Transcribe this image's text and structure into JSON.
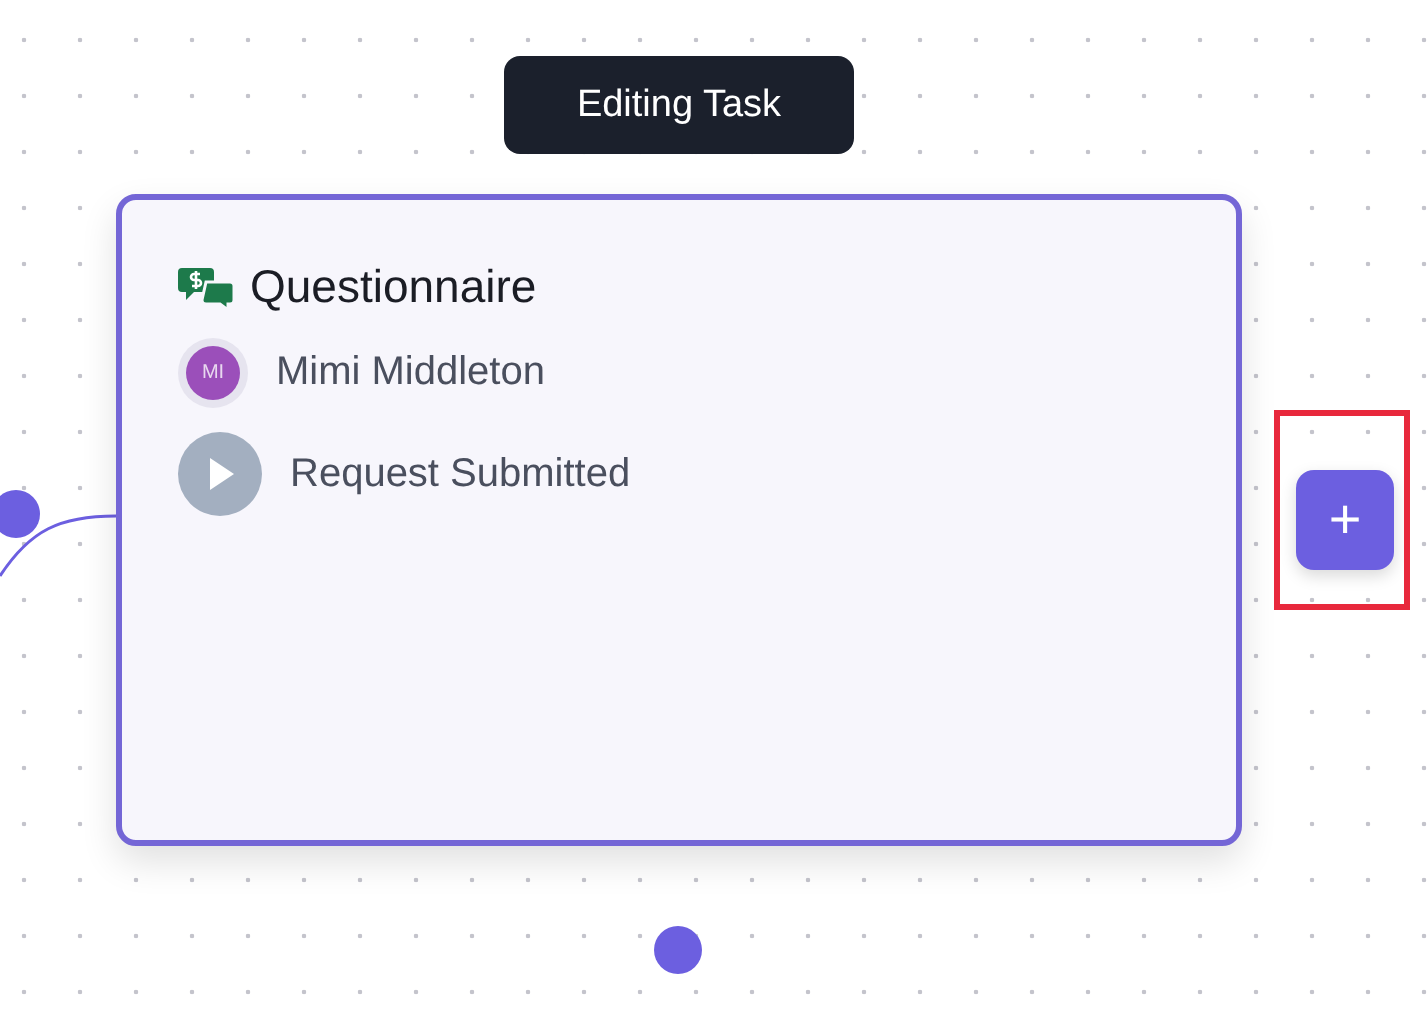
{
  "tooltip": "Editing Task",
  "node": {
    "title": "Questionnaire",
    "assignee": {
      "initials": "MI",
      "name": "Mimi Middleton"
    },
    "status": "Request Submitted",
    "selected": true
  },
  "add_button": {
    "label": "+",
    "highlighted": true
  }
}
